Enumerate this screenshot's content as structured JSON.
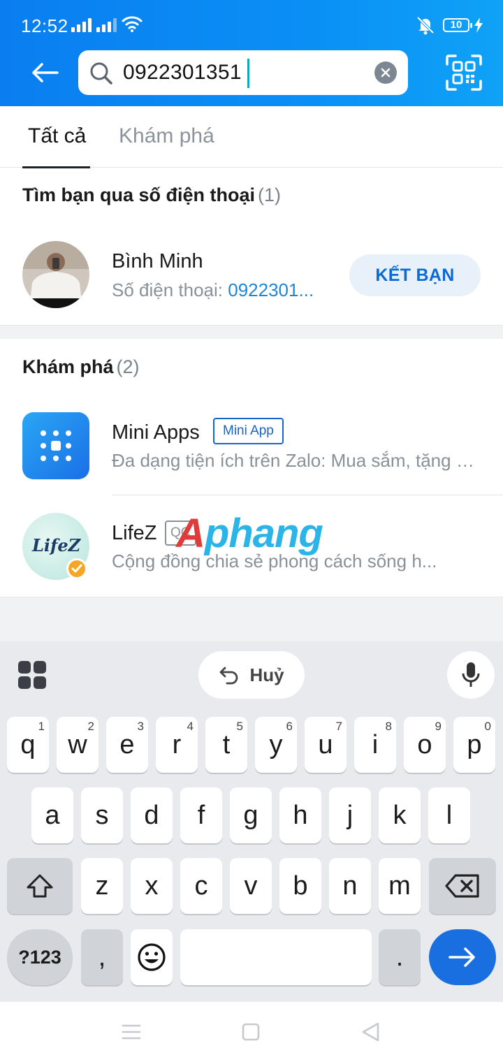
{
  "status_bar": {
    "time": "12:52",
    "battery": "10"
  },
  "search": {
    "value": "0922301351"
  },
  "tabs": [
    {
      "label": "Tất cả"
    },
    {
      "label": "Khám phá"
    }
  ],
  "phone_section": {
    "title": "Tìm bạn qua số điện thoại",
    "count": "(1)",
    "result": {
      "name": "Bình Minh",
      "sub_label": "Số điện thoại: ",
      "phone": "0922301...",
      "action": "KẾT BẠN"
    }
  },
  "explore_section": {
    "title": "Khám phá",
    "count": "(2)",
    "items": [
      {
        "name": "Mini Apps",
        "badge": "Mini App",
        "desc": "Đa dạng tiện ích trên Zalo: Mua sắm, tặng qu..."
      },
      {
        "name": "LifeZ",
        "badge": "QC",
        "desc": "Cộng đồng chia sẻ phong cách sống h...",
        "logo_text": "LifeZ"
      }
    ]
  },
  "watermark": {
    "first": "A",
    "rest": "phang"
  },
  "keyboard": {
    "undo_label": "Huỷ",
    "row1": [
      {
        "k": "q",
        "h": "1"
      },
      {
        "k": "w",
        "h": "2"
      },
      {
        "k": "e",
        "h": "3"
      },
      {
        "k": "r",
        "h": "4"
      },
      {
        "k": "t",
        "h": "5"
      },
      {
        "k": "y",
        "h": "6"
      },
      {
        "k": "u",
        "h": "7"
      },
      {
        "k": "i",
        "h": "8"
      },
      {
        "k": "o",
        "h": "9"
      },
      {
        "k": "p",
        "h": "0"
      }
    ],
    "row2": [
      "a",
      "s",
      "d",
      "f",
      "g",
      "h",
      "j",
      "k",
      "l"
    ],
    "row3": [
      "z",
      "x",
      "c",
      "v",
      "b",
      "n",
      "m"
    ],
    "symbols_label": "?123",
    "comma": ",",
    "period": "."
  },
  "colors": {
    "header": "#0a8ff5",
    "accent": "#1b87d9",
    "enter": "#1a6fe0"
  }
}
